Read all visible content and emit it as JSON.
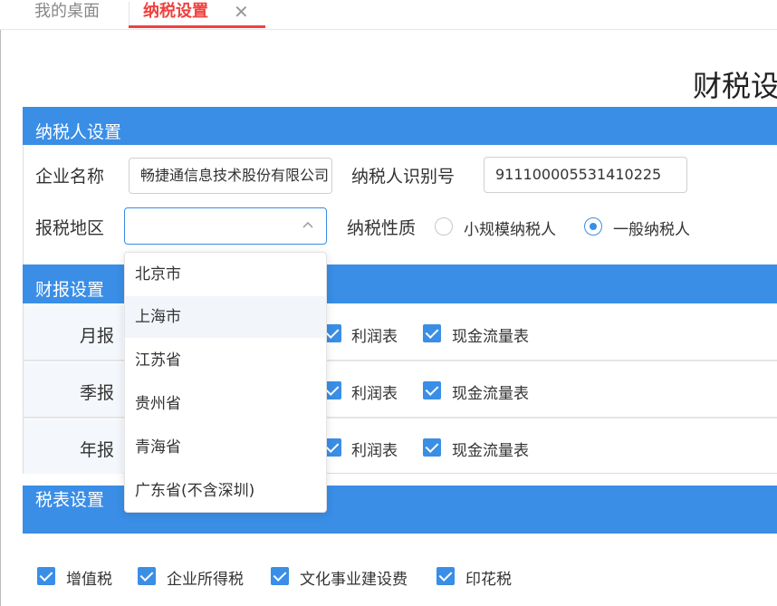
{
  "tabs": {
    "desktop_label": "我的桌面",
    "tax_settings_label": "纳税设置",
    "close_symbol": "✕"
  },
  "page": {
    "title": "财税设"
  },
  "sections": {
    "taxpayer_title": "纳税人设置",
    "report_title": "财报设置",
    "tax_forms_title": "税表设置"
  },
  "taxpayer": {
    "company_label": "企业名称",
    "company_value": "畅捷通信息技术股份有限公司",
    "taxid_label": "纳税人识别号",
    "taxid_value": "911100005531410225",
    "region_label": "报税地区",
    "region_value": "",
    "nature_label": "纳税性质",
    "nature_options": [
      {
        "label": "小规模纳税人",
        "checked": false
      },
      {
        "label": "一般纳税人",
        "checked": true
      }
    ]
  },
  "region_dropdown": {
    "options": [
      "北京市",
      "上海市",
      "江苏省",
      "贵州省",
      "青海省",
      "广东省(不含深圳)"
    ],
    "highlighted": "上海市"
  },
  "report_rows": [
    {
      "label": "月报",
      "items": [
        "利润表",
        "现金流量表"
      ]
    },
    {
      "label": "季报",
      "items": [
        "利润表",
        "现金流量表"
      ]
    },
    {
      "label": "年报",
      "items": [
        "利润表",
        "现金流量表"
      ]
    }
  ],
  "tax_forms": [
    "增值税",
    "企业所得税",
    "文化事业建设费",
    "印花税"
  ],
  "colors": {
    "accent": "#3a8ee6",
    "active_tab": "#f0413e"
  }
}
